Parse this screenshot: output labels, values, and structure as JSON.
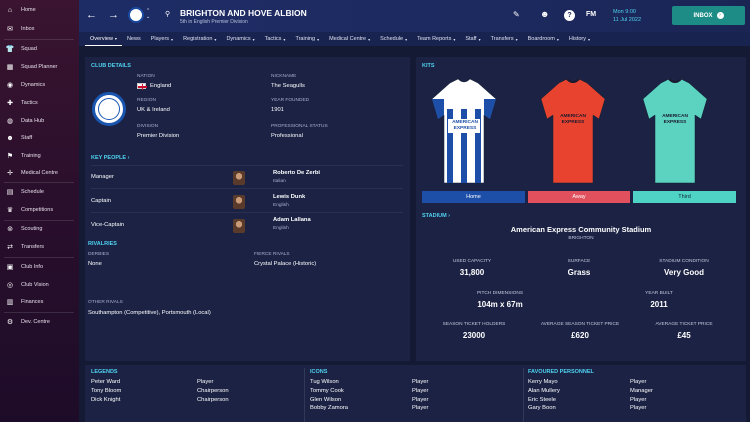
{
  "sidebar": {
    "items": [
      {
        "label": "Home",
        "icon": "home-icon"
      },
      {
        "label": "Inbox",
        "icon": "inbox-icon"
      },
      {
        "label": "Squad",
        "icon": "squad-icon"
      },
      {
        "label": "Squad Planner",
        "icon": "planner-icon"
      },
      {
        "label": "Dynamics",
        "icon": "dynamics-icon"
      },
      {
        "label": "Tactics",
        "icon": "tactics-icon"
      },
      {
        "label": "Data Hub",
        "icon": "data-hub-icon"
      },
      {
        "label": "Staff",
        "icon": "staff-icon"
      },
      {
        "label": "Training",
        "icon": "training-icon"
      },
      {
        "label": "Medical Centre",
        "icon": "medical-icon"
      },
      {
        "label": "Schedule",
        "icon": "calendar-icon"
      },
      {
        "label": "Competitions",
        "icon": "trophy-icon"
      },
      {
        "label": "Scouting",
        "icon": "binoculars-icon"
      },
      {
        "label": "Transfers",
        "icon": "transfers-icon"
      },
      {
        "label": "Club Info",
        "icon": "club-info-icon"
      },
      {
        "label": "Club Vision",
        "icon": "vision-icon"
      },
      {
        "label": "Finances",
        "icon": "finances-icon"
      },
      {
        "label": "Dev. Centre",
        "icon": "dev-centre-icon"
      }
    ]
  },
  "header": {
    "club_name": "BRIGHTON AND HOVE ALBION",
    "subtitle": "5th in English Premier Division",
    "date_line1": "Mon 9:00",
    "date_line2": "11 Jul 2022",
    "fm_label": "FM",
    "inbox_label": "INBOX"
  },
  "nav": {
    "tabs": [
      "Overview",
      "News",
      "Players",
      "Registration",
      "Dynamics",
      "Tactics",
      "Training",
      "Medical Centre",
      "Schedule",
      "Team Reports",
      "Staff",
      "Transfers",
      "Boardroom",
      "History"
    ]
  },
  "club_details": {
    "title": "CLUB DETAILS",
    "nation_label": "NATION",
    "nation": "England",
    "region_label": "REGION",
    "region": "UK & Ireland",
    "division_label": "DIVISION",
    "division": "Premier Division",
    "nickname_label": "NICKNAME",
    "nickname": "The Seagulls",
    "founded_label": "YEAR FOUNDED",
    "founded": "1901",
    "status_label": "PROFESSIONAL STATUS",
    "status": "Professional"
  },
  "key_people": {
    "title": "KEY PEOPLE",
    "rows": [
      {
        "role": "Manager",
        "name": "Roberto De Zerbi",
        "nat": "Italian"
      },
      {
        "role": "Captain",
        "name": "Lewis Dunk",
        "nat": "English"
      },
      {
        "role": "Vice-Captain",
        "name": "Adam Lallana",
        "nat": "English"
      }
    ]
  },
  "rivalries": {
    "title": "RIVALRIES",
    "derbies_label": "DERBIES",
    "derbies": "None",
    "fierce_label": "FIERCE RIVALS",
    "fierce": "Crystal Palace (Historic)",
    "other_label": "OTHER RIVALS",
    "other": "Southampton (Competitive), Portsmouth (Local)"
  },
  "kits": {
    "title": "KITS",
    "home": "Home",
    "away": "Away",
    "third": "Third",
    "sponsor_line1": "AMERICAN",
    "sponsor_line2": "EXPRESS",
    "colors": {
      "home_btn": "#1e4fa8",
      "away_btn": "#e0505d",
      "third_btn": "#4fd3c4"
    }
  },
  "stadium": {
    "title": "STADIUM",
    "name": "American Express Community Stadium",
    "city": "BRIGHTON",
    "used_capacity_label": "USED CAPACITY",
    "used_capacity": "31,800",
    "surface_label": "SURFACE",
    "surface": "Grass",
    "condition_label": "STADIUM CONDITION",
    "condition": "Very Good",
    "pitch_label": "PITCH DIMENSIONS",
    "pitch": "104m x 67m",
    "year_built_label": "YEAR BUILT",
    "year_built": "2011",
    "holders_label": "SEASON TICKET HOLDERS",
    "holders": "23000",
    "avg_season_label": "AVERAGE SEASON TICKET PRICE",
    "avg_season": "£620",
    "avg_ticket_label": "AVERAGE TICKET PRICE",
    "avg_ticket": "£45"
  },
  "legends": {
    "title": "LEGENDS",
    "rows": [
      {
        "name": "Peter Ward",
        "role": "Player"
      },
      {
        "name": "Tony Bloom",
        "role": "Chairperson"
      },
      {
        "name": "Dick Knight",
        "role": "Chairperson"
      }
    ]
  },
  "icons": {
    "title": "ICONS",
    "rows": [
      {
        "name": "Tug Wilson",
        "role": "Player"
      },
      {
        "name": "Tommy Cook",
        "role": "Player"
      },
      {
        "name": "Glen Wilson",
        "role": "Player"
      },
      {
        "name": "Bobby Zamora",
        "role": "Player"
      }
    ]
  },
  "favoured": {
    "title": "FAVOURED PERSONNEL",
    "rows": [
      {
        "name": "Kerry Mayo",
        "role": "Player"
      },
      {
        "name": "Alan Mullery",
        "role": "Manager"
      },
      {
        "name": "Eric Steele",
        "role": "Player"
      },
      {
        "name": "Gary Boon",
        "role": "Player"
      }
    ]
  }
}
